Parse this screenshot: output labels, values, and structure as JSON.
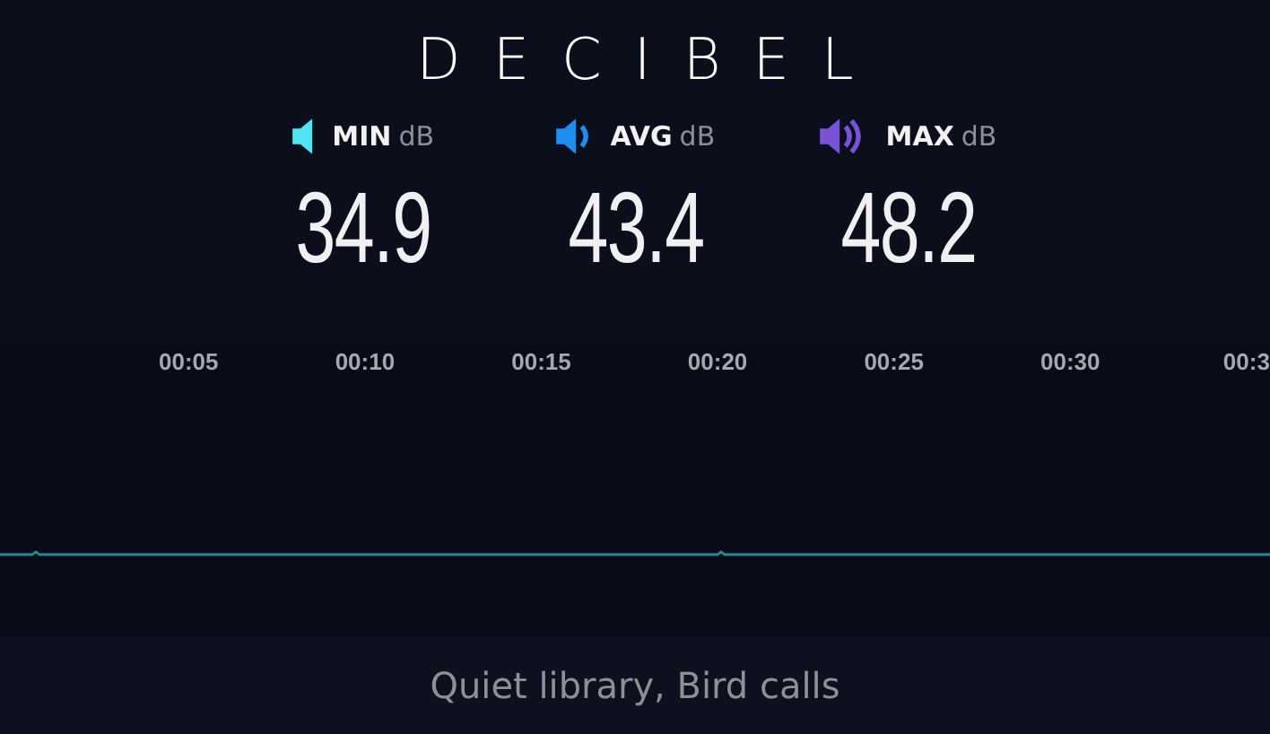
{
  "app": {
    "title": "DECIBEL"
  },
  "stats": [
    {
      "kind": "min",
      "label": "MIN",
      "unit": "dB",
      "value": "34.9",
      "color": "#4ee6f2"
    },
    {
      "kind": "avg",
      "label": "AVG",
      "unit": "dB",
      "value": "43.4",
      "color": "#1f8ef1"
    },
    {
      "kind": "max",
      "label": "MAX",
      "unit": "dB",
      "value": "48.2",
      "color": "#7b52d6"
    }
  ],
  "timeline": {
    "ticks": [
      "00:05",
      "00:10",
      "00:15",
      "00:20",
      "00:25",
      "00:30",
      "00:3"
    ]
  },
  "footer": {
    "tags": "Quiet library, Bird calls"
  }
}
